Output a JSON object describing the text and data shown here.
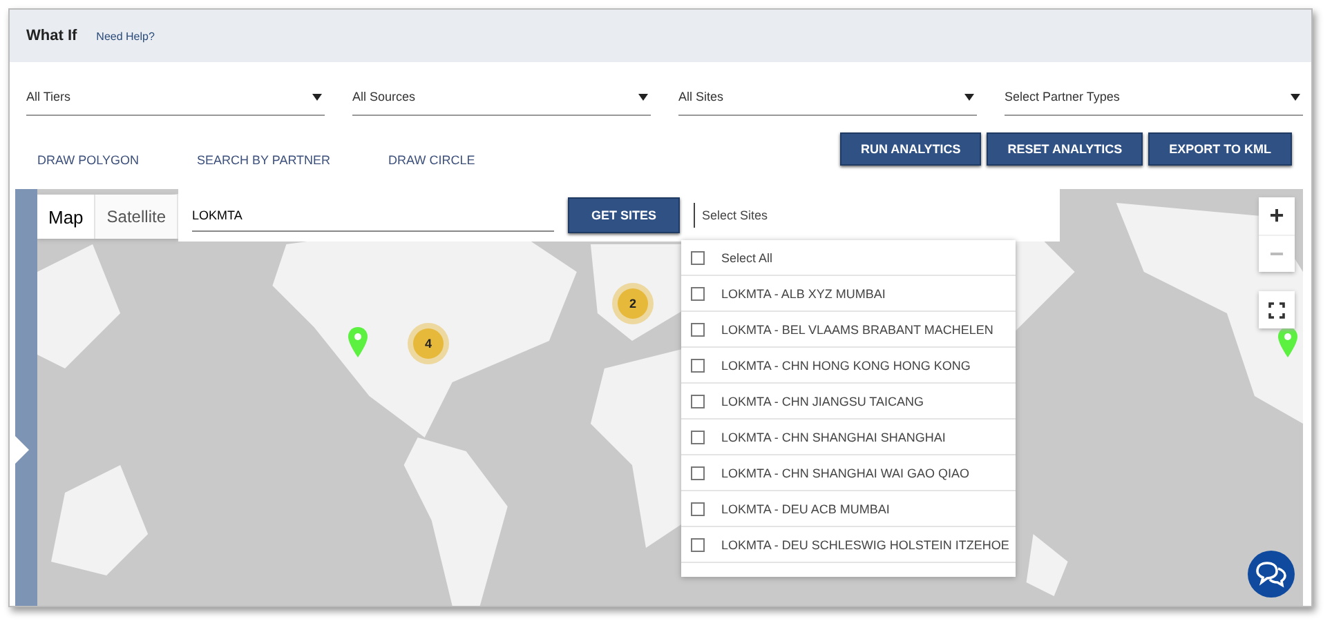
{
  "header": {
    "title": "What If",
    "help_link": "Need Help?"
  },
  "filters": [
    {
      "value": "All Tiers"
    },
    {
      "value": "All Sources"
    },
    {
      "value": "All Sites"
    },
    {
      "value": "Select Partner Types"
    }
  ],
  "draw_tools": [
    "DRAW POLYGON",
    "SEARCH BY PARTNER",
    "DRAW CIRCLE"
  ],
  "actions": [
    "RUN ANALYTICS",
    "RESET ANALYTICS",
    "EXPORT TO KML"
  ],
  "map": {
    "map_types": [
      {
        "label": "Map",
        "selected": true
      },
      {
        "label": "Satellite",
        "selected": false
      }
    ],
    "partner_search": {
      "value": "LOKMTA"
    },
    "get_sites_button": "GET SITES",
    "sites_select": {
      "placeholder": "Select Sites"
    },
    "sites_options": [
      {
        "label": "Select All",
        "checked": false
      },
      {
        "label": "LOKMTA - ALB XYZ MUMBAI",
        "checked": false
      },
      {
        "label": "LOKMTA - BEL VLAAMS BRABANT MACHELEN",
        "checked": false
      },
      {
        "label": "LOKMTA - CHN HONG KONG HONG KONG",
        "checked": false
      },
      {
        "label": "LOKMTA - CHN JIANGSU TAICANG",
        "checked": false
      },
      {
        "label": "LOKMTA - CHN SHANGHAI SHANGHAI",
        "checked": false
      },
      {
        "label": "LOKMTA - CHN SHANGHAI WAI GAO QIAO",
        "checked": false
      },
      {
        "label": "LOKMTA - DEU ACB MUMBAI",
        "checked": false
      },
      {
        "label": "LOKMTA - DEU SCHLESWIG HOLSTEIN ITZEHOE",
        "checked": false
      }
    ],
    "clusters": [
      {
        "count": "2"
      },
      {
        "count": "4"
      }
    ],
    "zoom_in": "+",
    "zoom_out": "−"
  }
}
